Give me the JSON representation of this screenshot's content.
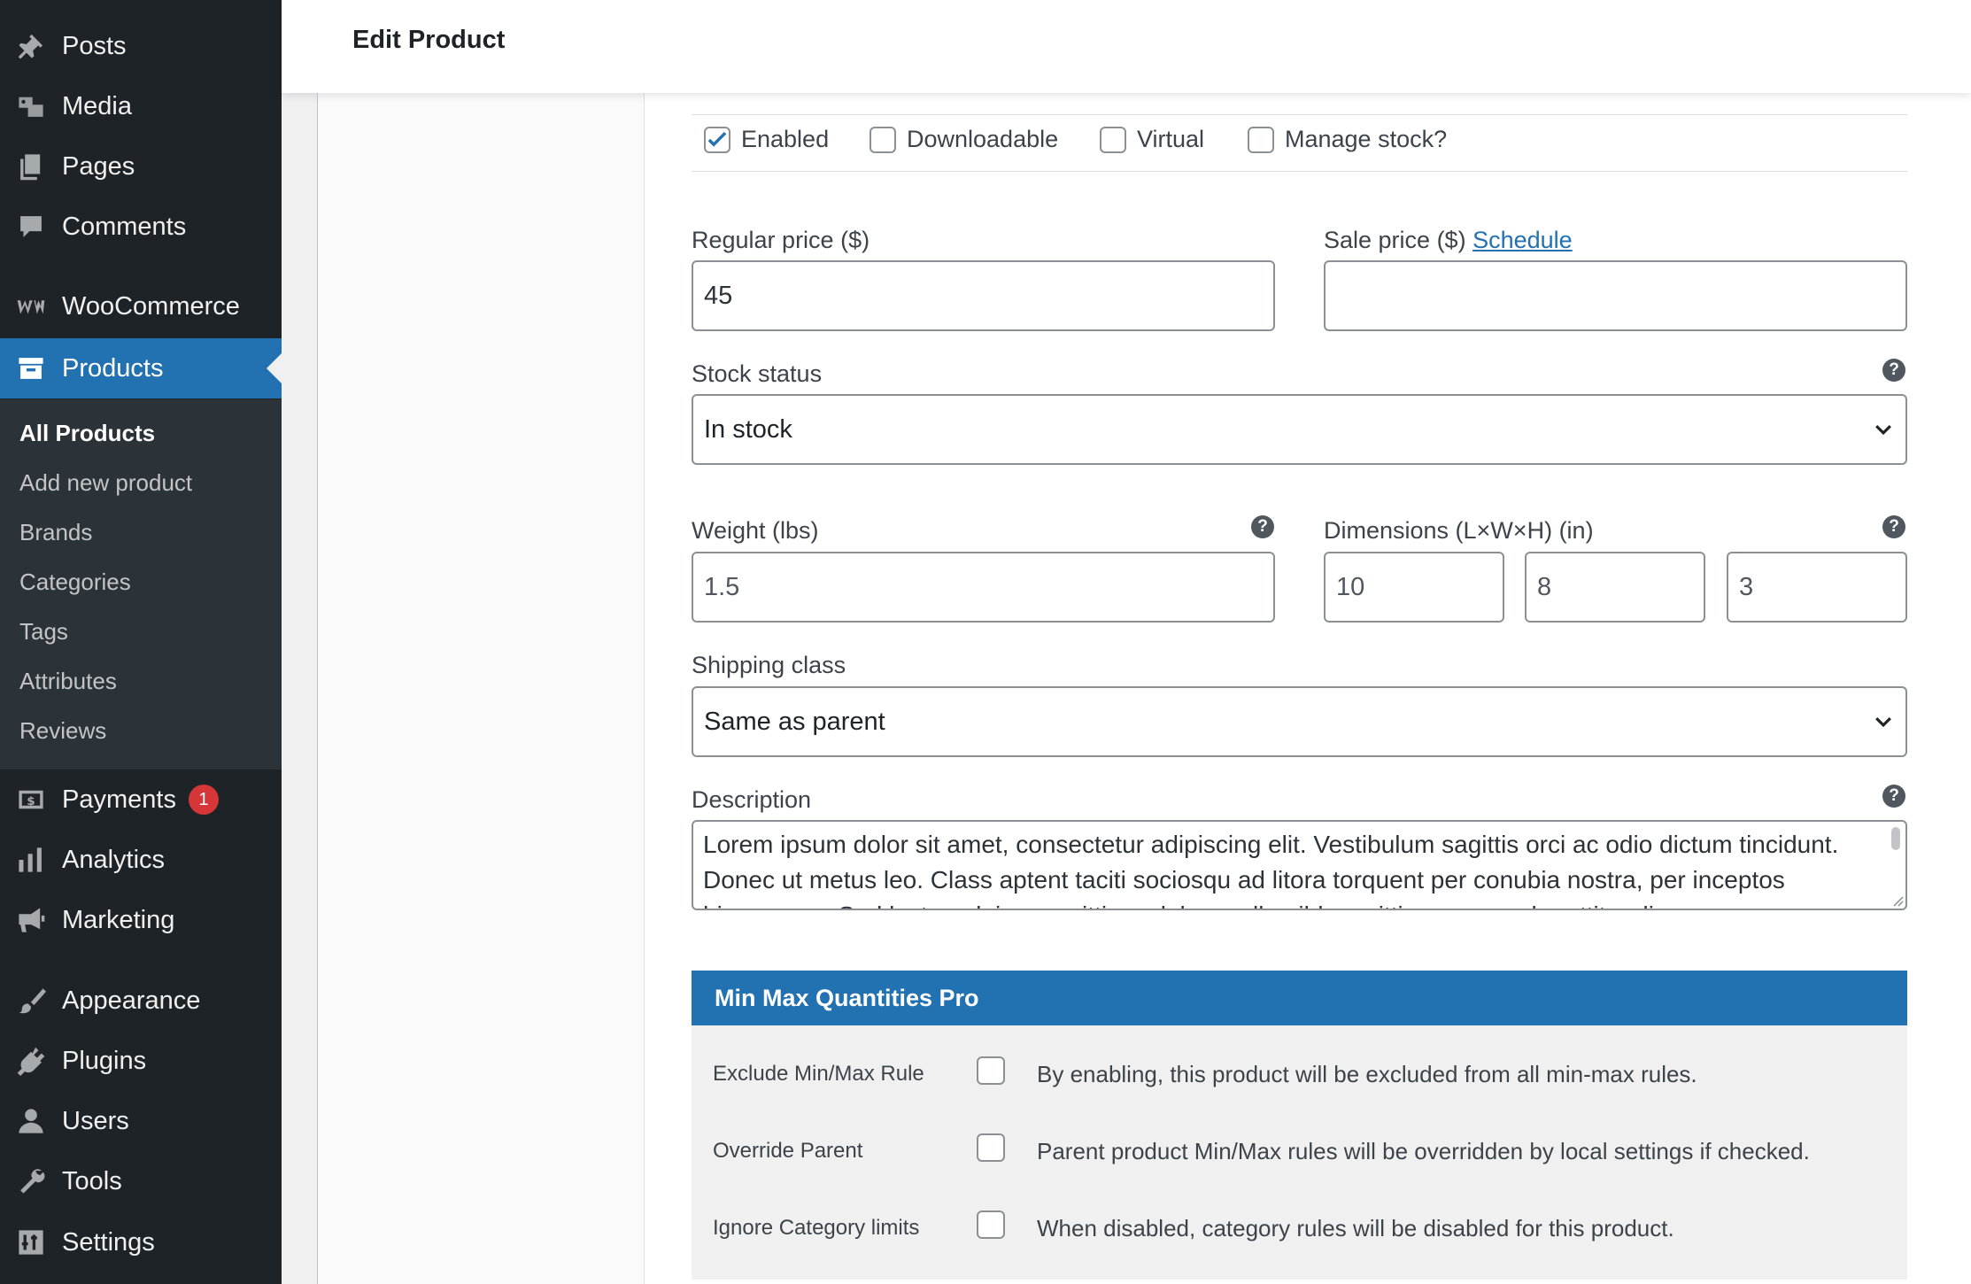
{
  "header": {
    "title": "Edit Product"
  },
  "sidebar": {
    "items": [
      {
        "label": "Posts",
        "icon": "pin-icon"
      },
      {
        "label": "Media",
        "icon": "media-icon"
      },
      {
        "label": "Pages",
        "icon": "pages-icon"
      },
      {
        "label": "Comments",
        "icon": "comment-icon"
      },
      {
        "label": "WooCommerce",
        "icon": "woocommerce-icon"
      },
      {
        "label": "Products",
        "icon": "archive-icon"
      },
      {
        "label": "Payments",
        "icon": "dollar-icon",
        "badge": "1"
      },
      {
        "label": "Analytics",
        "icon": "bar-chart-icon"
      },
      {
        "label": "Marketing",
        "icon": "megaphone-icon"
      },
      {
        "label": "Appearance",
        "icon": "paintbrush-icon"
      },
      {
        "label": "Plugins",
        "icon": "plug-icon"
      },
      {
        "label": "Users",
        "icon": "user-icon"
      },
      {
        "label": "Tools",
        "icon": "wrench-icon"
      },
      {
        "label": "Settings",
        "icon": "sliders-icon"
      }
    ],
    "submenu": [
      "All Products",
      "Add new product",
      "Brands",
      "Categories",
      "Tags",
      "Attributes",
      "Reviews"
    ]
  },
  "variation": {
    "options": [
      {
        "label": "Enabled",
        "checked": true
      },
      {
        "label": "Downloadable",
        "checked": false
      },
      {
        "label": "Virtual",
        "checked": false
      },
      {
        "label": "Manage stock?",
        "checked": false
      }
    ],
    "regular_price_label": "Regular price ($)",
    "regular_price_value": "45",
    "sale_price_label": "Sale price ($)",
    "sale_price_link": "Schedule",
    "sale_price_value": "",
    "stock_status_label": "Stock status",
    "stock_status_value": "In stock",
    "weight_label": "Weight (lbs)",
    "weight_value": "1.5",
    "dimensions_label": "Dimensions (L×W×H) (in)",
    "dim_length": "10",
    "dim_width": "8",
    "dim_height": "3",
    "shipping_class_label": "Shipping class",
    "shipping_class_value": "Same as parent",
    "description_label": "Description",
    "description_value": "Lorem ipsum dolor sit amet, consectetur adipiscing elit. Vestibulum sagittis orci ac odio dictum tincidunt. Donec ut metus leo. Class aptent taciti sociosqu ad litora torquent per conubia nostra, per inceptos himenaeos. Sed luctus, dui eu sagittis sodales, nulla nibh sagittis augue, vel porttitor diam",
    "help_glyph": "?"
  },
  "minmax": {
    "title": "Min Max Quantities Pro",
    "rows": [
      {
        "label": "Exclude Min/Max Rule",
        "desc": "By enabling, this product will be excluded from all min-max rules."
      },
      {
        "label": "Override Parent",
        "desc": "Parent product Min/Max rules will be overridden by local settings if checked."
      },
      {
        "label": "Ignore Category limits",
        "desc": "When disabled, category rules will be disabled for this product."
      }
    ]
  },
  "colors": {
    "accent": "#2271b1",
    "sidebar": "#1d2327",
    "submenu": "#2c3338",
    "badge": "#d63638"
  }
}
